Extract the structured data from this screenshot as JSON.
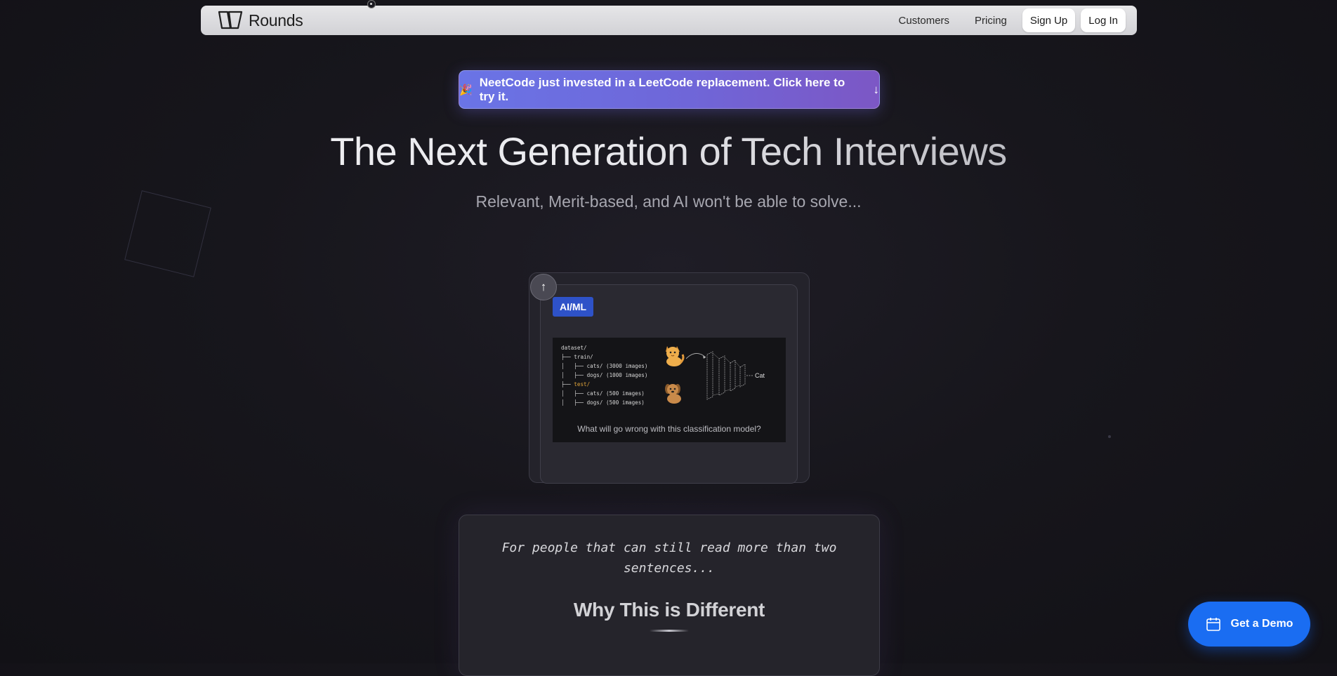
{
  "nav": {
    "brand": "Rounds",
    "links": [
      "Customers",
      "Pricing"
    ],
    "signup_label": "Sign Up",
    "login_label": "Log In"
  },
  "banner": {
    "emoji": "🎉",
    "text": "NeetCode just invested in a LeetCode replacement. Click here to try it.",
    "arrow": "↓"
  },
  "hero": {
    "title": "The Next Generation of Tech Interviews",
    "subtitle": "Relevant, Merit-based, and AI won't be able to solve..."
  },
  "card": {
    "scroll_up_icon": "↑",
    "tag": "AI/ML",
    "dataset_tree": [
      {
        "prefix": "",
        "name": "dataset/",
        "suffix": ""
      },
      {
        "prefix": "├── ",
        "name": "train/",
        "suffix": ""
      },
      {
        "prefix": "│   ├── ",
        "name": "cats/",
        "suffix": " (3000 images)"
      },
      {
        "prefix": "│   ├── ",
        "name": "dogs/",
        "suffix": " (1000 images)"
      },
      {
        "prefix": "├── ",
        "name": "test/",
        "suffix": "",
        "highlight": true
      },
      {
        "prefix": "│   ├── ",
        "name": "cats/",
        "suffix": " (500 images)"
      },
      {
        "prefix": "│   ├── ",
        "name": "dogs/",
        "suffix": " (500 images)"
      }
    ],
    "output_label": "Cat",
    "question": "What will go wrong with this classification model?"
  },
  "panel": {
    "quote": "For people that can still read more than two sentences...",
    "heading": "Why This is Different"
  },
  "demo": {
    "label": "Get a Demo",
    "icon": "calendar-icon",
    "color": "#1a6df2"
  },
  "colors": {
    "banner_start": "#6a74e6",
    "banner_end": "#7c57c5",
    "tag_bg": "#2e52c8",
    "highlight": "#e0a43a"
  }
}
